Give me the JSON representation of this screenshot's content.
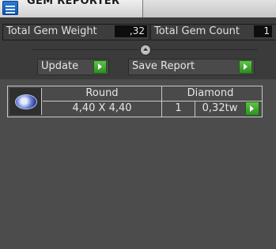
{
  "tab": {
    "title": "GEM REPORTER"
  },
  "stats": {
    "weight_label": "Total Gem Weight",
    "weight_value": ",32",
    "count_label": "Total Gem Count",
    "count_value": "1"
  },
  "actions": {
    "update_label": "Update",
    "save_label": "Save Report"
  },
  "gems": [
    {
      "shape": "Round",
      "material": "Diamond",
      "size": "4,40 X 4,40",
      "count": "1",
      "weight": "0,32tw"
    }
  ]
}
